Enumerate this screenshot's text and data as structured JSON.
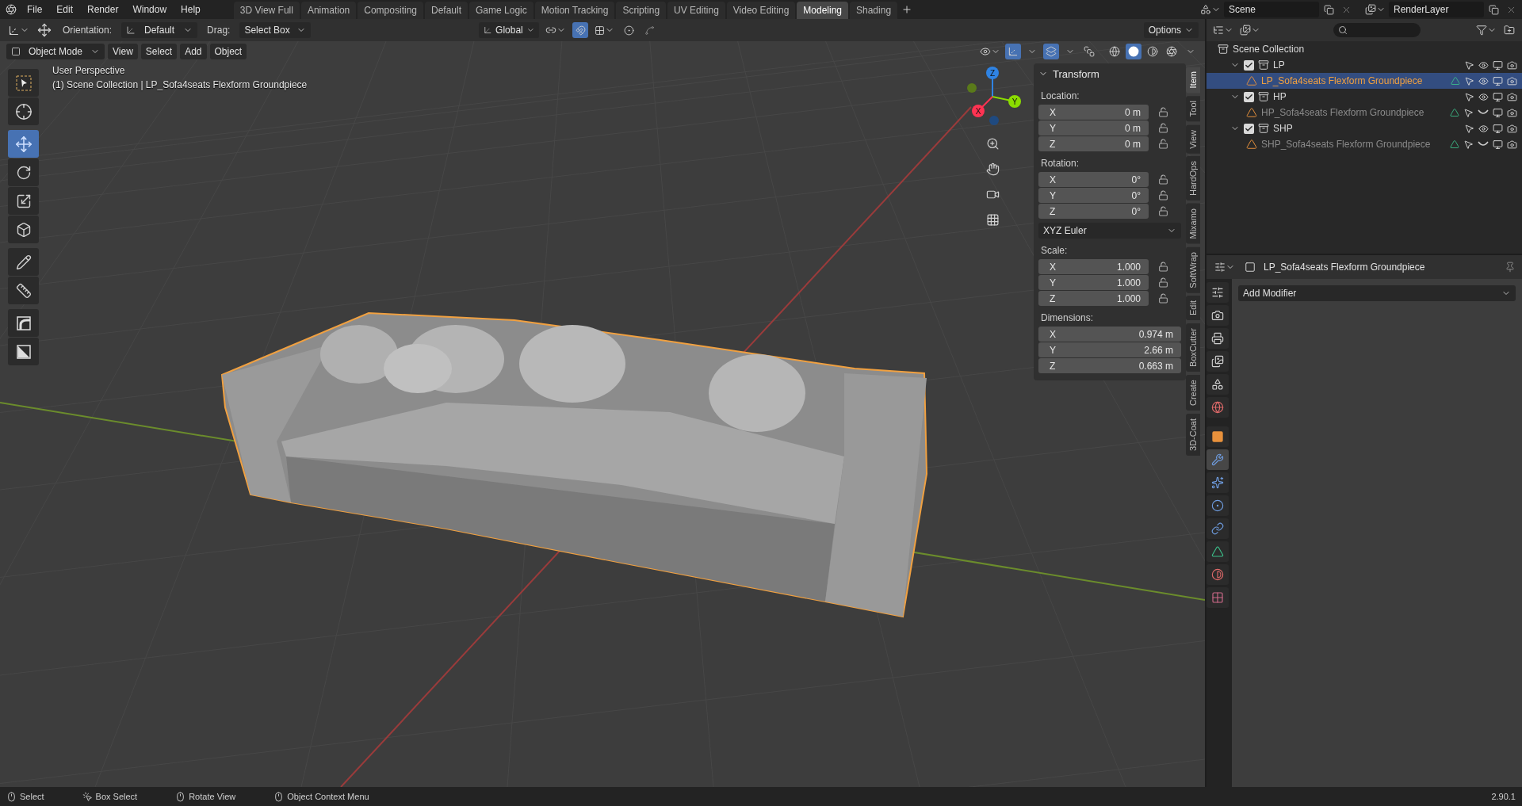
{
  "topbar": {
    "menus": [
      "File",
      "Edit",
      "Render",
      "Window",
      "Help"
    ],
    "workspaces": [
      {
        "label": "3D View Full",
        "selected": false
      },
      {
        "label": "Animation",
        "selected": false
      },
      {
        "label": "Compositing",
        "selected": false
      },
      {
        "label": "Default",
        "selected": false
      },
      {
        "label": "Game Logic",
        "selected": false
      },
      {
        "label": "Motion Tracking",
        "selected": false
      },
      {
        "label": "Scripting",
        "selected": false
      },
      {
        "label": "UV Editing",
        "selected": false
      },
      {
        "label": "Video Editing",
        "selected": false
      },
      {
        "label": "Modeling",
        "selected": true
      },
      {
        "label": "Shading",
        "selected": false
      }
    ],
    "scene": "Scene",
    "view_layer": "RenderLayer"
  },
  "tool_header": {
    "orientation_label": "Orientation:",
    "orientation": "Default",
    "drag_label": "Drag:",
    "drag": "Select Box",
    "transform_orientation": "Global",
    "snap_on": true,
    "options": "Options"
  },
  "viewport_header": {
    "mode": "Object Mode",
    "menus": [
      "View",
      "Select",
      "Add",
      "Object"
    ],
    "gizmos_on": true,
    "overlays_on": true,
    "xray_on": false,
    "shading": [
      {
        "kind": "wireframe",
        "selected": false
      },
      {
        "kind": "solid",
        "selected": true
      },
      {
        "kind": "material",
        "selected": false
      },
      {
        "kind": "rendered",
        "selected": false
      }
    ]
  },
  "viewport": {
    "kind": "picture",
    "perspective": "User Perspective",
    "context": "(1) Scene Collection | LP_Sofa4seats Flexform Groundpiece",
    "gizmo_axes": [
      "X",
      "Y",
      "Z"
    ]
  },
  "toolbar": [
    {
      "kind": "select_box",
      "selected": false
    },
    {
      "kind": "cursor",
      "selected": false
    },
    {
      "kind": "move",
      "selected": true
    },
    {
      "kind": "rotate",
      "selected": false
    },
    {
      "kind": "scale",
      "selected": false
    },
    {
      "kind": "transform",
      "selected": false
    },
    {
      "kind": "annotate",
      "selected": false
    },
    {
      "kind": "measure",
      "selected": false
    },
    {
      "kind": "bevel",
      "selected": false
    },
    {
      "kind": "cut",
      "selected": false
    }
  ],
  "sidebar": {
    "title": "Transform",
    "expanded": true,
    "groups": [
      {
        "label": "Location:",
        "fields": [
          {
            "axis": "X",
            "value": "0 m",
            "locked": false
          },
          {
            "axis": "Y",
            "value": "0 m",
            "locked": false
          },
          {
            "axis": "Z",
            "value": "0 m",
            "locked": false
          }
        ]
      },
      {
        "label": "Rotation:",
        "fields": [
          {
            "axis": "X",
            "value": "0°",
            "locked": false
          },
          {
            "axis": "Y",
            "value": "0°",
            "locked": false
          },
          {
            "axis": "Z",
            "value": "0°",
            "locked": false
          }
        ],
        "dropdown": "XYZ Euler"
      },
      {
        "label": "Scale:",
        "fields": [
          {
            "axis": "X",
            "value": "1.000",
            "locked": false
          },
          {
            "axis": "Y",
            "value": "1.000",
            "locked": false
          },
          {
            "axis": "Z",
            "value": "1.000",
            "locked": false
          }
        ]
      },
      {
        "label": "Dimensions:",
        "fields": [
          {
            "axis": "X",
            "value": "0.974 m"
          },
          {
            "axis": "Y",
            "value": "2.66 m"
          },
          {
            "axis": "Z",
            "value": "0.663 m"
          }
        ]
      }
    ],
    "tabs": [
      {
        "label": "Item",
        "selected": true
      },
      {
        "label": "Tool",
        "selected": false
      },
      {
        "label": "View",
        "selected": false
      },
      {
        "label": "HardOps",
        "selected": false
      },
      {
        "label": "Mixamo",
        "selected": false
      },
      {
        "label": "SoftWrap",
        "selected": false
      },
      {
        "label": "Edit",
        "selected": false
      },
      {
        "label": "BoxCutter",
        "selected": false
      },
      {
        "label": "Create",
        "selected": false
      },
      {
        "label": "3D-Coat",
        "selected": false
      }
    ]
  },
  "outliner": {
    "root": "Scene Collection",
    "collections": [
      {
        "name": "LP",
        "expanded": true,
        "checked": true,
        "children": [
          {
            "name": "LP_Sofa4seats Flexform Groundpiece",
            "selected": true,
            "visible": true
          }
        ]
      },
      {
        "name": "HP",
        "expanded": true,
        "checked": true,
        "children": [
          {
            "name": "HP_Sofa4seats Flexform Groundpiece",
            "selected": false,
            "visible": false
          }
        ]
      },
      {
        "name": "SHP",
        "expanded": true,
        "checked": true,
        "children": [
          {
            "name": "SHP_Sofa4seats Flexform Groundpiece",
            "selected": false,
            "visible": false
          }
        ]
      }
    ]
  },
  "properties": {
    "object": "LP_Sofa4seats Flexform Groundpiece",
    "add_modifier": "Add Modifier",
    "tabs": [
      {
        "kind": "tool",
        "selected": false
      },
      {
        "kind": "render",
        "selected": false
      },
      {
        "kind": "output",
        "selected": false
      },
      {
        "kind": "view_layer",
        "selected": false
      },
      {
        "kind": "scene",
        "selected": false
      },
      {
        "kind": "world",
        "selected": false
      },
      {
        "kind": "object",
        "selected": false
      },
      {
        "kind": "modifiers",
        "selected": true
      },
      {
        "kind": "particles",
        "selected": false
      },
      {
        "kind": "physics",
        "selected": false
      },
      {
        "kind": "constraints",
        "selected": false
      },
      {
        "kind": "data",
        "selected": false
      },
      {
        "kind": "material",
        "selected": false
      },
      {
        "kind": "texture",
        "selected": false
      }
    ]
  },
  "status_bar": {
    "hints": [
      {
        "kind": "left",
        "label": "Select"
      },
      {
        "kind": "drag",
        "label": "Box Select"
      },
      {
        "kind": "middle",
        "label": "Rotate View"
      },
      {
        "kind": "right",
        "label": "Object Context Menu"
      }
    ],
    "version": "2.90.1"
  }
}
